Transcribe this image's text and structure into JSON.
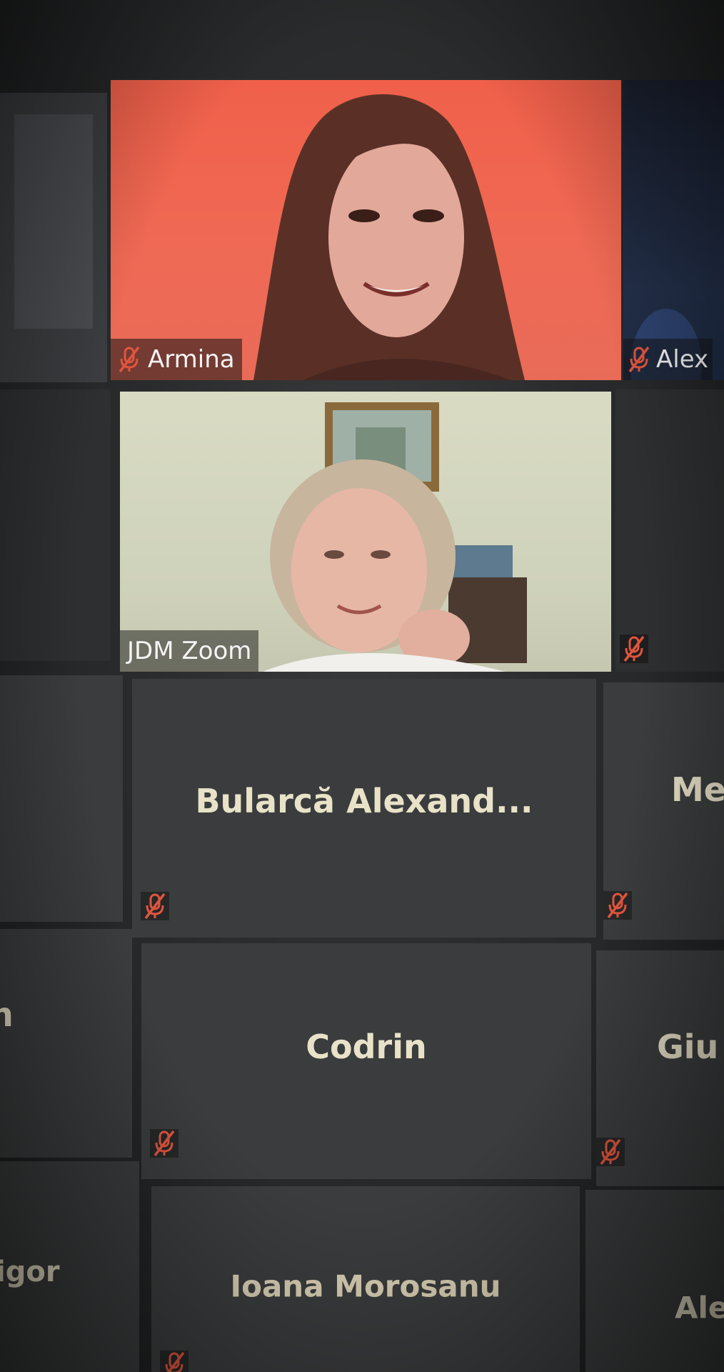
{
  "participants": {
    "armina": {
      "name": "Armina",
      "muted": true
    },
    "alex_top": {
      "name": "Alex",
      "muted": true
    },
    "jdm": {
      "name": "JDM Zoom",
      "muted": false
    },
    "bularca": {
      "name": "Bularcă  Alexand...",
      "muted": true
    },
    "me_partial": {
      "name": "Me",
      "muted": true
    },
    "codrin": {
      "name": "Codrin",
      "muted": true
    },
    "giu_partial": {
      "name": "Giu",
      "muted": true
    },
    "n_partial": {
      "name": "n",
      "muted": false
    },
    "igor_partial": {
      "name": "igor",
      "muted": false
    },
    "ioana": {
      "name": "Ioana Morosanu",
      "muted": true
    },
    "ale_partial": {
      "name": "Ale",
      "muted": false
    }
  },
  "colors": {
    "tile_bg": "#3b3c3d",
    "name_text": "#e8e2c8",
    "mute_icon": "#e0553e",
    "armina_bg": "#f0604a"
  }
}
